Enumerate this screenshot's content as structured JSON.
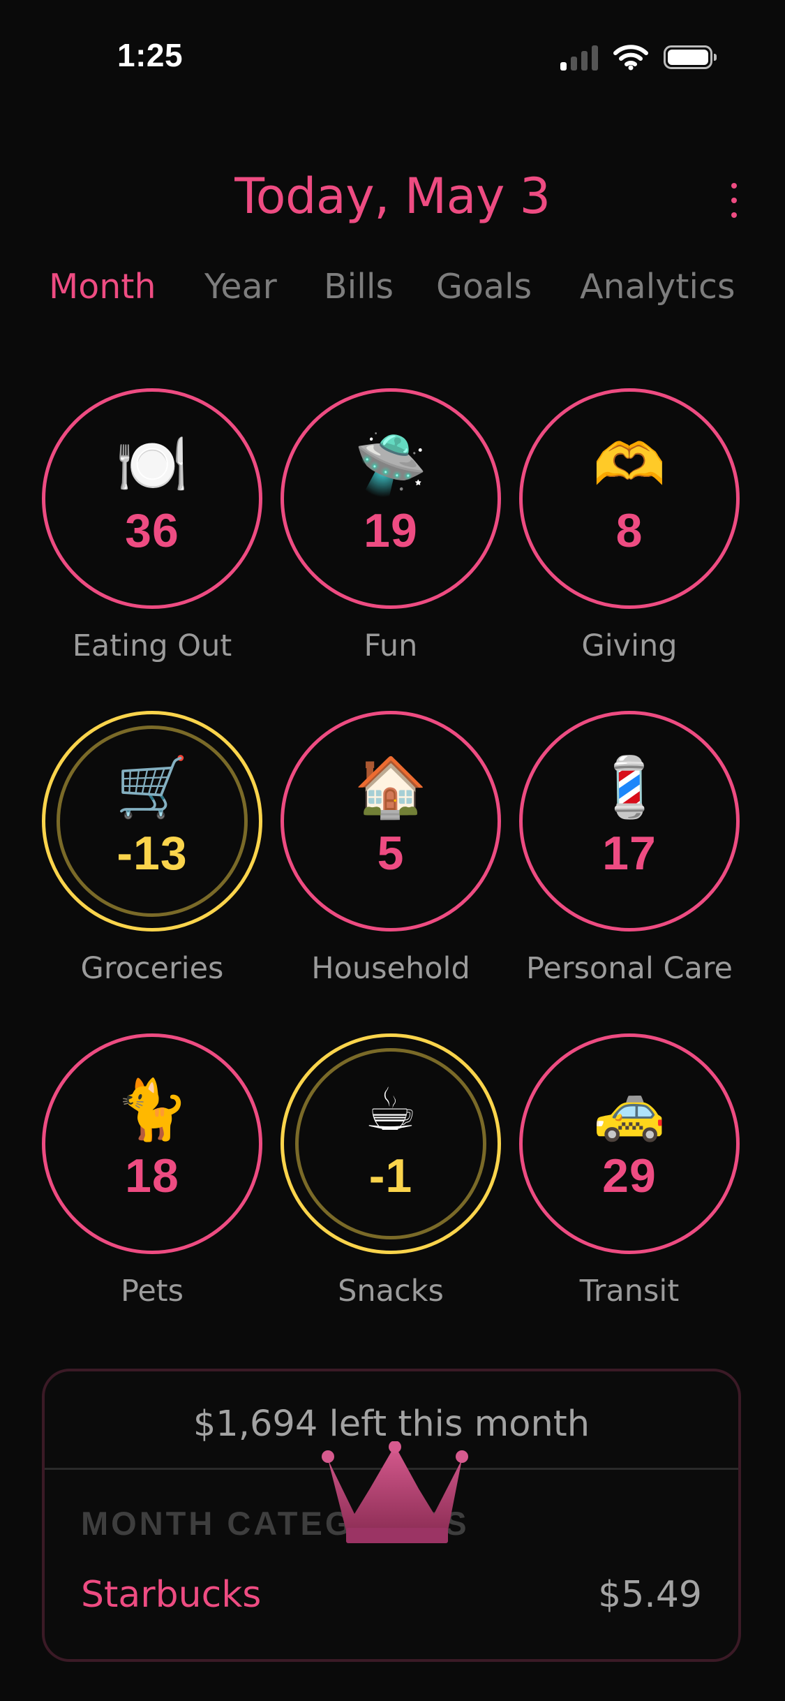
{
  "status_bar": {
    "time": "1:25",
    "signal_icon": "cellular-signal-icon",
    "wifi_icon": "wifi-icon",
    "battery_icon": "battery-icon"
  },
  "header": {
    "title": "Today, May 3",
    "menu_icon": "more-vertical-icon"
  },
  "tabs": [
    {
      "label": "Month",
      "active": true
    },
    {
      "label": "Year",
      "active": false
    },
    {
      "label": "Bills",
      "active": false
    },
    {
      "label": "Goals",
      "active": false
    },
    {
      "label": "Analytics",
      "active": false
    }
  ],
  "categories": [
    {
      "emoji": "🍽️",
      "icon": "plate-icon",
      "amount": "36",
      "label": "Eating Out",
      "status": "ok"
    },
    {
      "emoji": "🛸",
      "icon": "ufo-icon",
      "amount": "19",
      "label": "Fun",
      "status": "ok"
    },
    {
      "emoji": "🫶",
      "icon": "heart-hands-icon",
      "amount": "8",
      "label": "Giving",
      "status": "ok"
    },
    {
      "emoji": "🛒",
      "icon": "shopping-cart-icon",
      "amount": "-13",
      "label": "Groceries",
      "status": "over"
    },
    {
      "emoji": "🏠",
      "icon": "house-icon",
      "amount": "5",
      "label": "Household",
      "status": "ok"
    },
    {
      "emoji": "💈",
      "icon": "barber-pole-icon",
      "amount": "17",
      "label": "Personal Care",
      "status": "ok"
    },
    {
      "emoji": "🐈",
      "icon": "cat-icon",
      "amount": "18",
      "label": "Pets",
      "status": "ok"
    },
    {
      "emoji": "☕",
      "icon": "coffee-icon",
      "amount": "-1",
      "label": "Snacks",
      "status": "over"
    },
    {
      "emoji": "🚕",
      "icon": "taxi-icon",
      "amount": "29",
      "label": "Transit",
      "status": "ok"
    }
  ],
  "summary": {
    "left_text": "$1,694 left this month",
    "section_heading": "MONTH CATEGORIES",
    "crown_icon": "crown-icon",
    "transactions": [
      {
        "name": "Starbucks",
        "amount": "$5.49"
      }
    ]
  },
  "colors": {
    "accent": "#ee4c82",
    "warning": "#fad44c",
    "background": "#0a0a0a",
    "muted": "#9b9b9b"
  }
}
